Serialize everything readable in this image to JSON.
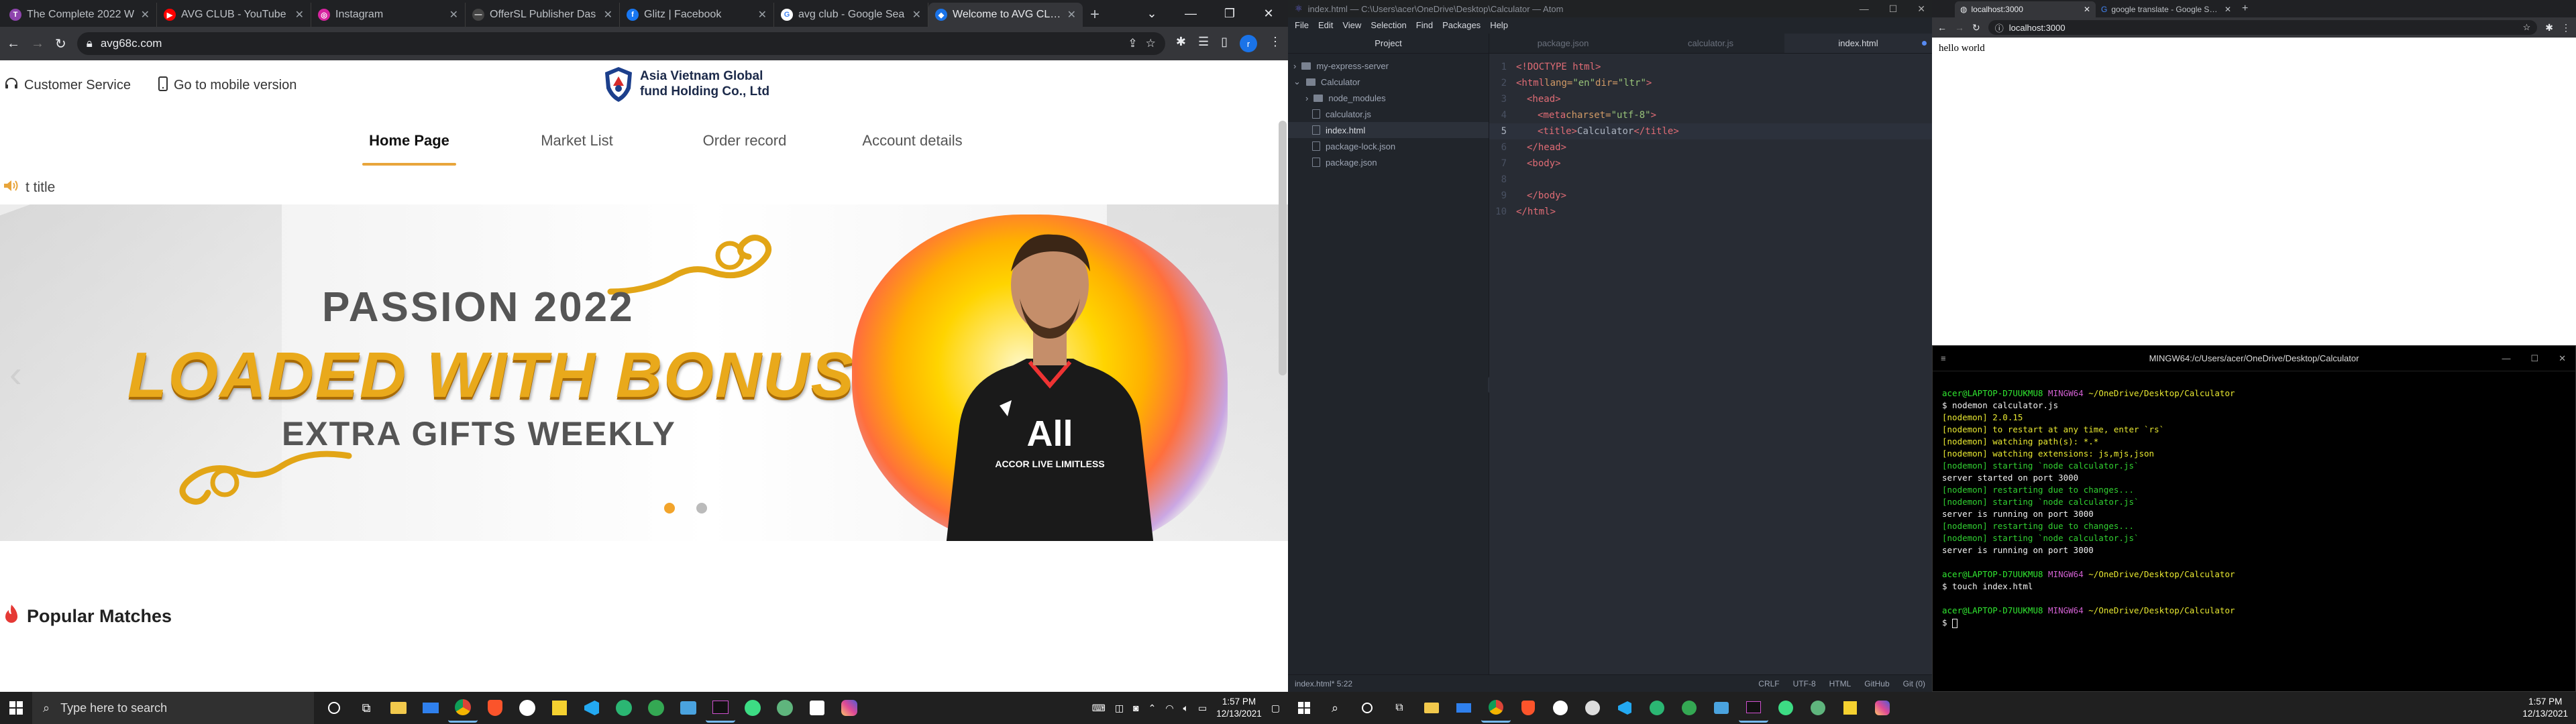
{
  "left_browser": {
    "tabs": [
      {
        "title": "The Complete 2022 W",
        "color": "#8e44ad",
        "glyph": "T"
      },
      {
        "title": "AVG CLUB - YouTube",
        "color": "#ff0000",
        "glyph": "▶"
      },
      {
        "title": "Instagram",
        "color": "#d6249f",
        "glyph": "◎"
      },
      {
        "title": "OfferSL Publisher Das",
        "color": "#444444",
        "glyph": "—"
      },
      {
        "title": "Glitz | Facebook",
        "color": "#1877f2",
        "glyph": "f"
      },
      {
        "title": "avg club - Google Sea",
        "color": "#ffffff",
        "glyph": "G"
      },
      {
        "title": "Welcome to AVG CLUB",
        "color": "#1a73e8",
        "glyph": "◆",
        "active": true
      }
    ],
    "url": "avg68c.com",
    "profile_initial": "r"
  },
  "site": {
    "customer_service": "Customer Service",
    "mobile_version": "Go to mobile version",
    "logo_line1": "Asia Vietnam Global",
    "logo_line2": "fund Holding Co., Ltd",
    "nav": [
      "Home Page",
      "Market List",
      "Order record",
      "Account details"
    ],
    "notice": "t title",
    "banner": {
      "line1": "PASSION 2022",
      "line2": "LOADED WITH BONUS",
      "line3": "EXTRA GIFTS WEEKLY",
      "jersey_text": "All",
      "jersey_sub": "ACCOR LIVE LIMITLESS"
    },
    "popular_matches": "Popular Matches",
    "accent_color": "#e8a53b"
  },
  "atom": {
    "title": "index.html — C:\\Users\\acer\\OneDrive\\Desktop\\Calculator — Atom",
    "menu": [
      "File",
      "Edit",
      "View",
      "Selection",
      "Find",
      "Packages",
      "Help"
    ],
    "tree_header": "Project",
    "tree": [
      {
        "label": "my-express-server",
        "type": "folder",
        "depth": 0,
        "open": false
      },
      {
        "label": "Calculator",
        "type": "folder",
        "depth": 0,
        "open": true
      },
      {
        "label": "node_modules",
        "type": "folder",
        "depth": 1,
        "open": false
      },
      {
        "label": "calculator.js",
        "type": "file",
        "depth": 1
      },
      {
        "label": "index.html",
        "type": "file",
        "depth": 1,
        "selected": true
      },
      {
        "label": "package-lock.json",
        "type": "file",
        "depth": 1
      },
      {
        "label": "package.json",
        "type": "file",
        "depth": 1
      }
    ],
    "tabs": [
      "package.json",
      "calculator.js",
      "index.html"
    ],
    "code": {
      "l1": "<!DOCTYPE html>",
      "l2a": "<html",
      "l2b": " lang=",
      "l2c": "\"en\"",
      "l2d": " dir=",
      "l2e": "\"ltr\"",
      "l2f": ">",
      "l3": "<head>",
      "l4a": "<meta",
      "l4b": " charset=",
      "l4c": "\"utf-8\"",
      "l4d": ">",
      "l5a": "<title>",
      "l5b": "Calculator",
      "l5c": "</title>",
      "l6": "</head>",
      "l7": "<body>",
      "l9": "</body>",
      "l10": "</html>"
    },
    "status_left": "index.html*   5:22",
    "status_right": [
      "CRLF",
      "UTF-8",
      "HTML",
      "GitHub",
      "Git (0)"
    ]
  },
  "right_browser": {
    "tabs": [
      "localhost:3000",
      "google translate - Google Search"
    ],
    "url": "localhost:3000",
    "body_text": "hello world"
  },
  "terminal": {
    "title": "MINGW64:/c/Users/acer/OneDrive/Desktop/Calculator",
    "user": "acer@LAPTOP-D7UUKMU8",
    "shell": "MINGW64",
    "path": "~/OneDrive/Desktop/Calculator",
    "cmd1": "$ nodemon calculator.js",
    "lines1": [
      {
        "t": "[nodemon] 2.0.15",
        "c": "yellow"
      },
      {
        "t": "[nodemon] to restart at any time, enter `rs`",
        "c": "yellow"
      },
      {
        "t": "[nodemon] watching path(s): *.*",
        "c": "yellow"
      },
      {
        "t": "[nodemon] watching extensions: js,mjs,json",
        "c": "yellow"
      },
      {
        "t": "[nodemon] starting `node calculator.js`",
        "c": "ygreen"
      },
      {
        "t": "server started on port 3000",
        "c": "white"
      },
      {
        "t": "[nodemon] restarting due to changes...",
        "c": "ygreen"
      },
      {
        "t": "[nodemon] starting `node calculator.js`",
        "c": "ygreen"
      },
      {
        "t": "server is running on port 3000",
        "c": "white"
      },
      {
        "t": "[nodemon] restarting due to changes...",
        "c": "ygreen"
      },
      {
        "t": "[nodemon] starting `node calculator.js`",
        "c": "ygreen"
      },
      {
        "t": "server is running on port 3000",
        "c": "white"
      }
    ],
    "cmd2": "$ touch index.html",
    "cmd3": "$ "
  },
  "taskbar": {
    "search_placeholder": "Type here to search",
    "time": "1:57 PM",
    "date": "12/13/2021"
  }
}
